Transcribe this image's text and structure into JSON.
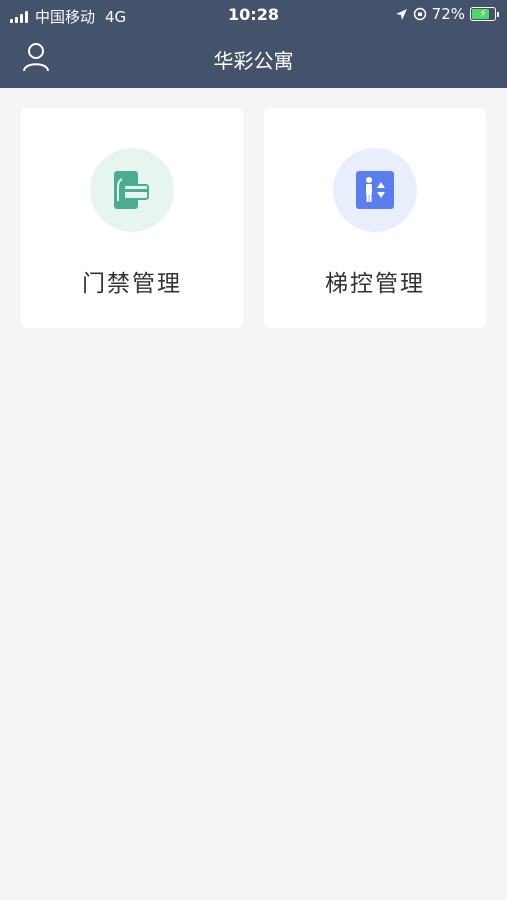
{
  "status_bar": {
    "carrier": "中国移动",
    "network": "4G",
    "time": "10:28",
    "battery_percent": "72%",
    "battery_level": 0.72
  },
  "header": {
    "title": "华彩公寓",
    "user_icon": "user-icon"
  },
  "menu": [
    {
      "label": "门禁管理",
      "icon": "access-card-icon",
      "icon_bg": "#e6f5f0",
      "icon_color": "#4cab91"
    },
    {
      "label": "梯控管理",
      "icon": "elevator-icon",
      "icon_bg": "#e8eefc",
      "icon_color": "#5a7ef0"
    }
  ],
  "colors": {
    "header_bg": "#44526b",
    "page_bg": "#f5f5f5",
    "card_bg": "#ffffff"
  }
}
